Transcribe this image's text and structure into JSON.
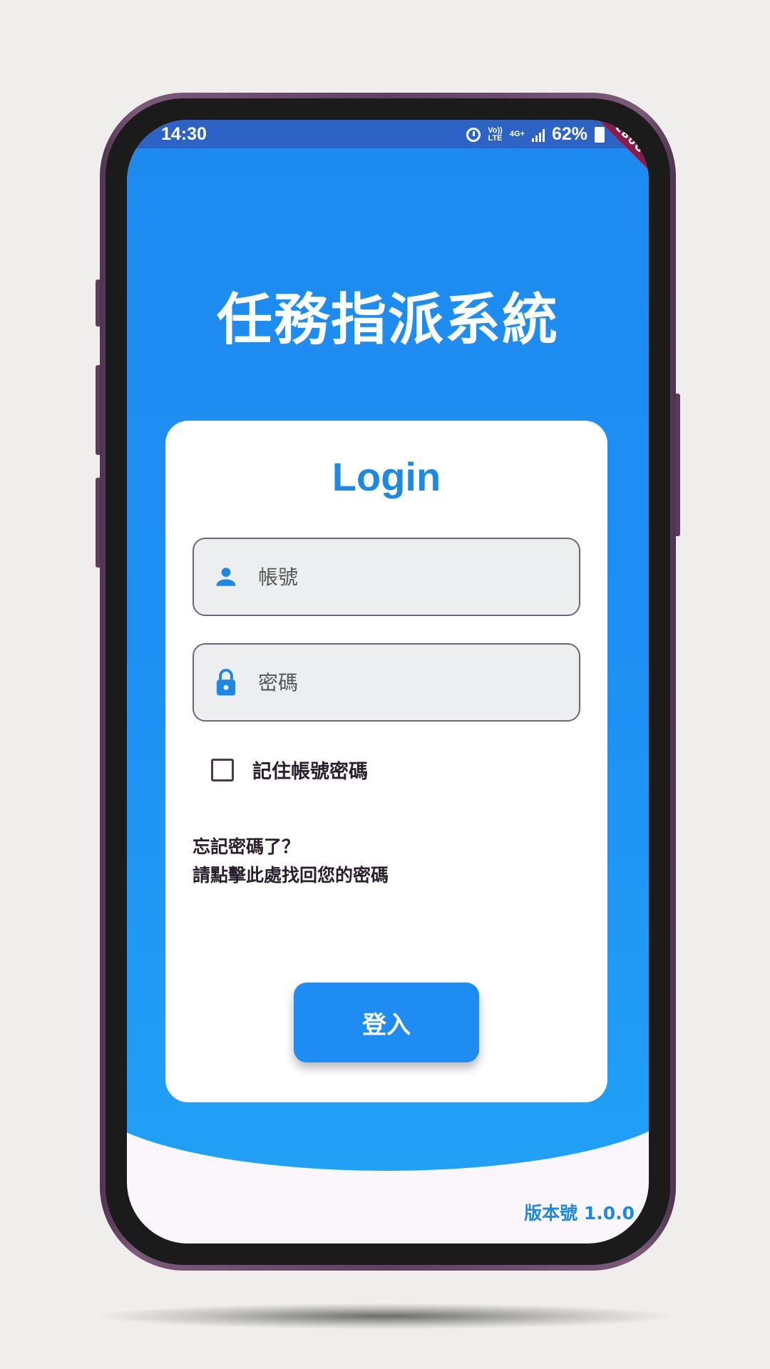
{
  "status_bar": {
    "time": "14:30",
    "volte": "Vo))",
    "lte": "LTE",
    "network": "4G+",
    "battery": "62%"
  },
  "debug_banner": "DEBUG",
  "app_title": "任務指派系統",
  "login": {
    "title": "Login",
    "username_placeholder": "帳號",
    "password_placeholder": "密碼",
    "remember_label": "記住帳號密碼",
    "remember_checked": false,
    "forgot_line1": "忘記密碼了？",
    "forgot_line2": "請點擊此處找回您的密碼",
    "submit_label": "登入"
  },
  "version": "版本號 1.0.0",
  "icons": {
    "username": "person-icon",
    "password": "lock-icon"
  },
  "colors": {
    "primary": "#1e88e5",
    "hero_top": "#1d8af0",
    "status_bar": "#2c63c4",
    "field_bg": "#eceef0",
    "screen_bg": "#fbf6fb"
  }
}
